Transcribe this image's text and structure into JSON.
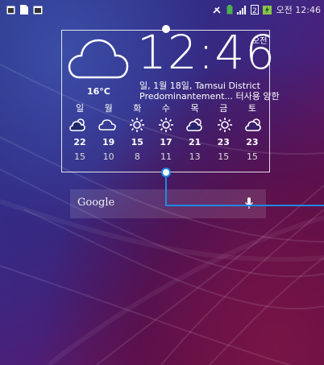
{
  "statusbar": {
    "right_time": "오전 12:46",
    "notification_icons": [
      "calendar-icon",
      "document-icon",
      "screen-icon"
    ],
    "status_icons": [
      "mute-icon",
      "battery-green-icon",
      "signal-icon",
      "sim-icon",
      "charging-icon"
    ]
  },
  "widget": {
    "time": "12:46",
    "ampm": "오전",
    "current_temp": "16°C",
    "date_location": "일, 1월 18일, Tamsui District",
    "description": "Predominantement... 터사용 양한",
    "forecast": [
      {
        "day": "일",
        "icon": "partly-sunny-icon",
        "high": "22",
        "low": "15"
      },
      {
        "day": "월",
        "icon": "cloudy-icon",
        "high": "19",
        "low": "10"
      },
      {
        "day": "화",
        "icon": "sunny-icon",
        "high": "15",
        "low": "8"
      },
      {
        "day": "수",
        "icon": "sunny-icon",
        "high": "17",
        "low": "11"
      },
      {
        "day": "목",
        "icon": "partly-sunny-icon",
        "high": "21",
        "low": "13"
      },
      {
        "day": "금",
        "icon": "sunny-icon",
        "high": "23",
        "low": "15"
      },
      {
        "day": "토",
        "icon": "partly-sunny-icon",
        "high": "23",
        "low": "15"
      }
    ]
  },
  "search": {
    "label": "Google",
    "icon": "mic-icon"
  },
  "colors": {
    "handle_blue": "#1e88e5",
    "battery_green": "#4caf50"
  }
}
